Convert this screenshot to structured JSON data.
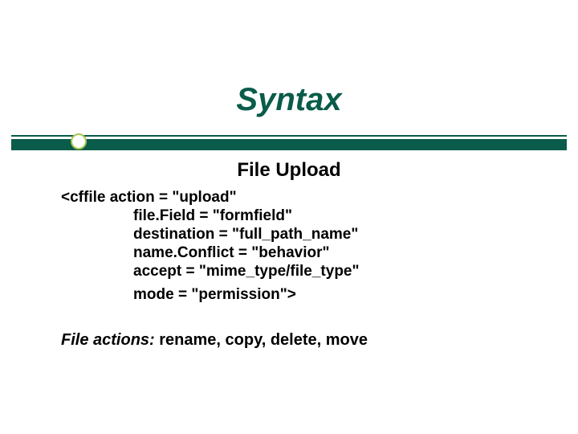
{
  "title": "Syntax",
  "subtitle": "File Upload",
  "code": {
    "l1": "<cffile action = \"upload\"",
    "l2": "file.Field = \"formfield\"",
    "l3": "destination = \"full_path_name\"",
    "l4": "name.Conflict = \"behavior\"",
    "l5": "accept = \"mime_type/file_type\"",
    "l6": "mode = \"permission\">"
  },
  "actions": {
    "label": "File actions: ",
    "values": "rename, copy, delete, move"
  }
}
